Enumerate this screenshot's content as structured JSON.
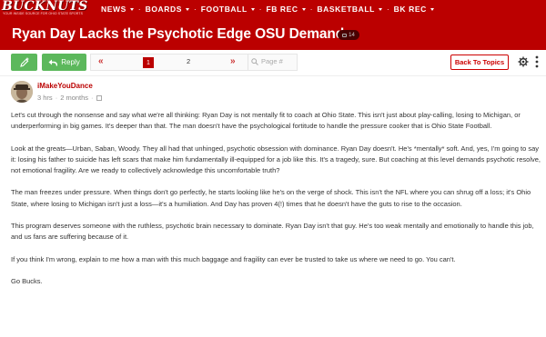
{
  "brand": {
    "logo_text": "BUCKNUTS",
    "tagline": "YOUR INSIDE SOURCE FOR OHIO STATE SPORTS",
    "accent_color": "#bb0000",
    "button_color": "#5cb85c"
  },
  "nav": {
    "items": [
      {
        "label": "NEWS",
        "has_dropdown": true
      },
      {
        "label": "BOARDS",
        "has_dropdown": true
      },
      {
        "label": "FOOTBALL",
        "has_dropdown": true
      },
      {
        "label": "FB REC",
        "has_dropdown": true
      },
      {
        "label": "BASKETBALL",
        "has_dropdown": true
      },
      {
        "label": "BK REC",
        "has_dropdown": true
      }
    ],
    "separator": "·"
  },
  "thread": {
    "title": "Ryan Day Lacks the Psychotic Edge OSU Demands",
    "badge_count": "14"
  },
  "toolbar": {
    "new_icon": "pencil-plus-icon",
    "reply_label": "Reply",
    "pages": [
      "1",
      "2"
    ],
    "current_page": "1",
    "page_input_placeholder": "Page #",
    "back_label": "Back To Topics"
  },
  "post": {
    "username": "iMakeYouDance",
    "time": "3 hrs",
    "edited": "2 months",
    "paragraphs": [
      "Let's cut through the nonsense and say what we're all thinking: Ryan Day is not mentally fit to coach at Ohio State. This isn't just about play-calling, losing to Michigan, or underperforming in big games. It's deeper than that. The man doesn't have the psychological fortitude to handle the pressure cooker that is Ohio State Football.",
      "Look at the greats—Urban, Saban, Woody. They all had that unhinged, psychotic obsession with dominance. Ryan Day doesn't. He's *mentally* soft. And, yes, I'm going to say it: losing his father to suicide has left scars that make him fundamentally ill-equipped for a job like this. It's a tragedy, sure. But coaching at this level demands psychotic resolve, not emotional fragility. Are we ready to collectively acknowledge this uncomfortable truth?",
      "The man freezes under pressure. When things don't go perfectly, he starts looking like he's on the verge of shock. This isn't the NFL where you can shrug off a loss; it's Ohio State, where losing to Michigan isn't just a loss—it's a humiliation. And Day has proven 4(!) times that he doesn't have the guts to rise to the occasion.",
      "This program deserves someone with the ruthless, psychotic brain necessary to dominate. Ryan Day isn't that guy. He's too weak mentally and emotionally to handle this job, and us fans are suffering because of it.",
      "If you think I'm wrong, explain to me how a man with this much baggage and fragility can ever be trusted to take us where we need to go. You can't.",
      "Go Bucks."
    ]
  }
}
